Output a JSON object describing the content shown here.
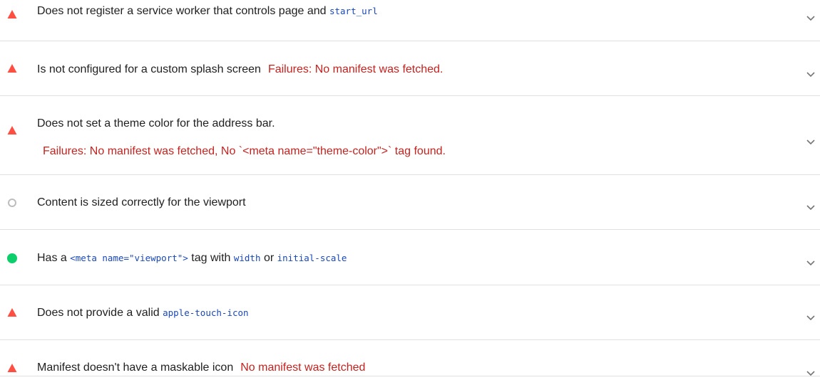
{
  "audits": [
    {
      "status": "fail",
      "parts": [
        "Does not register a service worker that controls page and ",
        "start_url"
      ],
      "failure_line": null
    },
    {
      "status": "fail",
      "text": "Is not configured for a custom splash screen",
      "failure": "Failures: No manifest was fetched."
    },
    {
      "status": "fail",
      "text": "Does not set a theme color for the address bar.",
      "failure_line": "Failures: No manifest was fetched, No `<meta name=\"theme-color\">` tag found."
    },
    {
      "status": "informative",
      "text": "Content is sized correctly for the viewport"
    },
    {
      "status": "pass",
      "parts": [
        "Has a ",
        "<meta name=\"viewport\">",
        " tag with ",
        "width",
        " or ",
        "initial-scale"
      ]
    },
    {
      "status": "fail",
      "parts": [
        "Does not provide a valid ",
        "apple-touch-icon"
      ]
    },
    {
      "status": "fail",
      "text": "Manifest doesn't have a maskable icon",
      "failure": "No manifest was fetched"
    }
  ],
  "colors": {
    "fail": "#ff4e42",
    "pass": "#0cce6b",
    "informative": "#bdbdbd",
    "failure_text": "#c5221f",
    "code": "#1a47b8"
  },
  "icons": {
    "fail": "red-triangle-icon",
    "pass": "green-circle-icon",
    "informative": "gray-circle-outline-icon",
    "expand": "chevron-down-icon"
  }
}
